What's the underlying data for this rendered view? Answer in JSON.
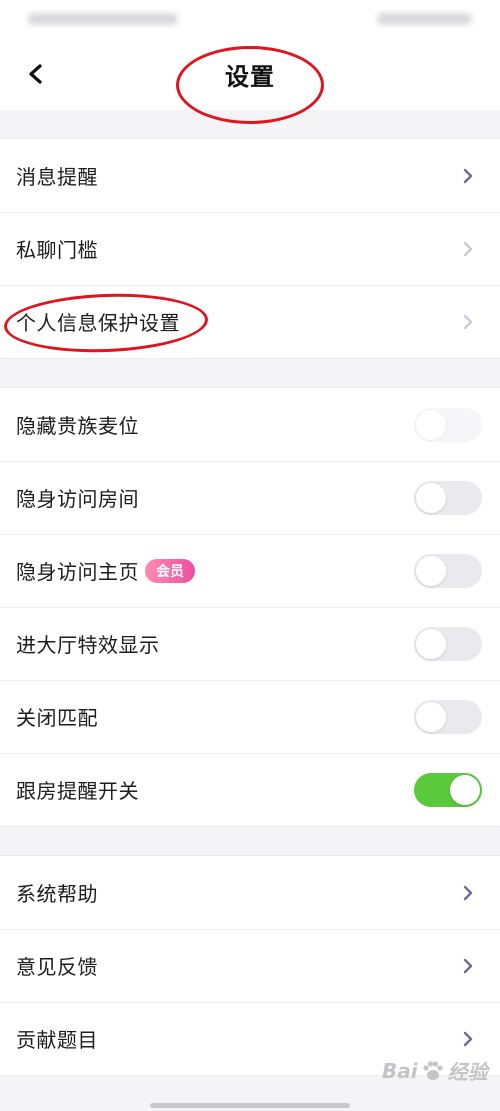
{
  "header": {
    "title": "设置"
  },
  "groups": {
    "g1": [
      {
        "label": "消息提醒"
      },
      {
        "label": "私聊门槛"
      },
      {
        "label": "个人信息保护设置"
      }
    ],
    "g2": [
      {
        "label": "隐藏贵族麦位",
        "toggle": "off"
      },
      {
        "label": "隐身访问房间",
        "toggle": "off"
      },
      {
        "label": "隐身访问主页",
        "badge": "会员",
        "toggle": "off"
      },
      {
        "label": "进大厅特效显示",
        "toggle": "off"
      },
      {
        "label": "关闭匹配",
        "toggle": "off"
      },
      {
        "label": "跟房提醒开关",
        "toggle": "on"
      }
    ],
    "g3": [
      {
        "label": "系统帮助"
      },
      {
        "label": "意见反馈"
      },
      {
        "label": "贡献题目"
      }
    ]
  },
  "watermark": {
    "left": "Bai",
    "right": "经验"
  },
  "colors": {
    "toggle_on": "#5ac93b",
    "toggle_off": "#eaeaee",
    "chevron": "#6e6a96",
    "badge": "#ec4fa0",
    "annotation": "#e0141e"
  },
  "icons": {
    "back": "chevron-left-icon",
    "row_nav": "chevron-right-icon",
    "watermark": "paw-icon"
  }
}
